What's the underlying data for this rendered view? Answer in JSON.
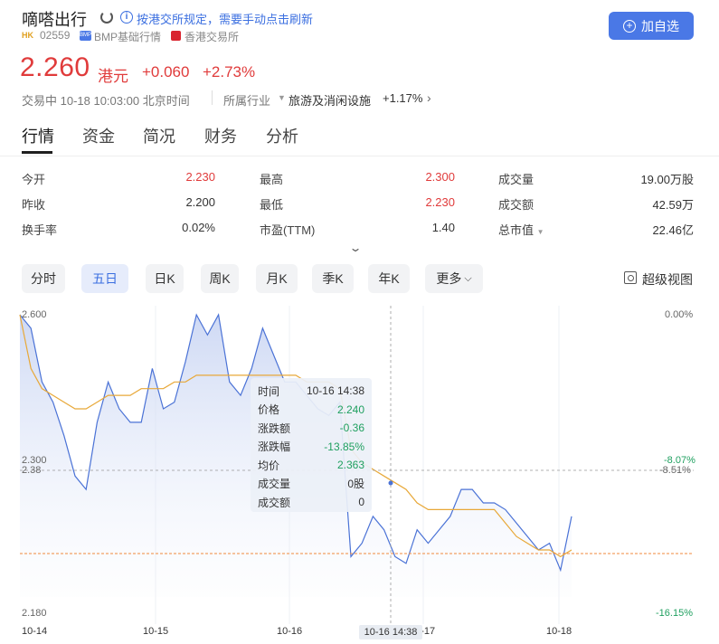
{
  "header": {
    "title": "嘀嗒出行",
    "notice": "按港交所规定，需要手动点击刷新",
    "market_badge": "HK",
    "code": "02559",
    "bmp_icon_text": "BMP",
    "bmp_text": "BMP基础行情",
    "exchange": "香港交易所",
    "watch_button": "加自选"
  },
  "quote": {
    "price": "2.260",
    "currency": "港元",
    "change": "+0.060",
    "change_pct": "+2.73%",
    "status": "交易中 10-18 10:03:00 北京时间",
    "industry_label": "所属行业",
    "industry_name": "旅游及消闲设施",
    "industry_pct": "+1.17%"
  },
  "tabs": [
    "行情",
    "资金",
    "简况",
    "财务",
    "分析"
  ],
  "stats": [
    {
      "label": "今开",
      "value": "2.230",
      "color": "red"
    },
    {
      "label": "最高",
      "value": "2.300",
      "color": "red"
    },
    {
      "label": "成交量",
      "value": "19.00万股",
      "color": "dark"
    },
    {
      "label": "昨收",
      "value": "2.200",
      "color": "dark"
    },
    {
      "label": "最低",
      "value": "2.230",
      "color": "red"
    },
    {
      "label": "成交额",
      "value": "42.59万",
      "color": "dark"
    },
    {
      "label": "换手率",
      "value": "0.02%",
      "color": "dark"
    },
    {
      "label": "市盈(TTM)",
      "value": "1.40",
      "color": "dark"
    },
    {
      "label": "总市值",
      "value": "22.46亿",
      "color": "dark"
    }
  ],
  "periods": [
    "分时",
    "五日",
    "日K",
    "周K",
    "月K",
    "季K",
    "年K",
    "更多"
  ],
  "active_period": "五日",
  "super_view": "超级视图",
  "tooltip": {
    "rows": [
      {
        "label": "时间",
        "value": "10-16 14:38"
      },
      {
        "label": "价格",
        "value": "2.240"
      },
      {
        "label": "涨跌额",
        "value": "-0.36"
      },
      {
        "label": "涨跌幅",
        "value": "-13.85%"
      },
      {
        "label": "均价",
        "value": "2.363"
      },
      {
        "label": "成交量",
        "value": "0股"
      },
      {
        "label": "成交额",
        "value": "0"
      }
    ]
  },
  "chart_axes": {
    "y_top": "2.600",
    "y_mid": "2.300",
    "y_bottom": "2.180",
    "pct_top": "0.00%",
    "pct_mid": "-8.07%",
    "pct_bottom": "-16.15%",
    "prev_close_price": "2.38",
    "prev_close_pct": "-8.51%",
    "dates": [
      "10-14",
      "10-15",
      "10-16",
      "10-17",
      "10-18"
    ],
    "cursor_label": "10-16 14:38"
  },
  "chart_data": {
    "type": "line",
    "x_categories": [
      "10-14",
      "10-15",
      "10-16",
      "10-17",
      "10-18"
    ],
    "ylim": [
      2.18,
      2.6
    ],
    "series": [
      {
        "values": [
          2.6,
          2.58,
          2.5,
          2.47,
          2.42,
          2.36,
          2.34,
          2.44,
          2.5,
          2.46,
          2.44,
          2.44,
          2.52,
          2.46,
          2.47,
          2.53,
          2.6,
          2.57,
          2.6,
          2.5,
          2.48,
          2.52,
          2.58,
          2.54,
          2.5,
          2.5,
          2.48,
          2.46,
          2.45,
          2.47,
          2.24,
          2.26,
          2.3,
          2.28,
          2.24,
          2.23,
          2.28,
          2.26,
          2.28,
          2.3,
          2.34,
          2.34,
          2.32,
          2.32,
          2.31,
          2.29,
          2.27,
          2.25,
          2.26,
          2.22,
          2.3
        ]
      },
      {
        "values": [
          2.6,
          2.52,
          2.49,
          2.48,
          2.47,
          2.46,
          2.46,
          2.47,
          2.48,
          2.48,
          2.48,
          2.49,
          2.49,
          2.49,
          2.5,
          2.5,
          2.51,
          2.51,
          2.51,
          2.51,
          2.51,
          2.51,
          2.51,
          2.51,
          2.51,
          2.51,
          2.5,
          2.5,
          2.5,
          2.49,
          2.4,
          2.38,
          2.37,
          2.36,
          2.35,
          2.34,
          2.32,
          2.31,
          2.31,
          2.31,
          2.31,
          2.31,
          2.31,
          2.31,
          2.29,
          2.27,
          2.26,
          2.25,
          2.25,
          2.24,
          2.25
        ]
      }
    ]
  }
}
